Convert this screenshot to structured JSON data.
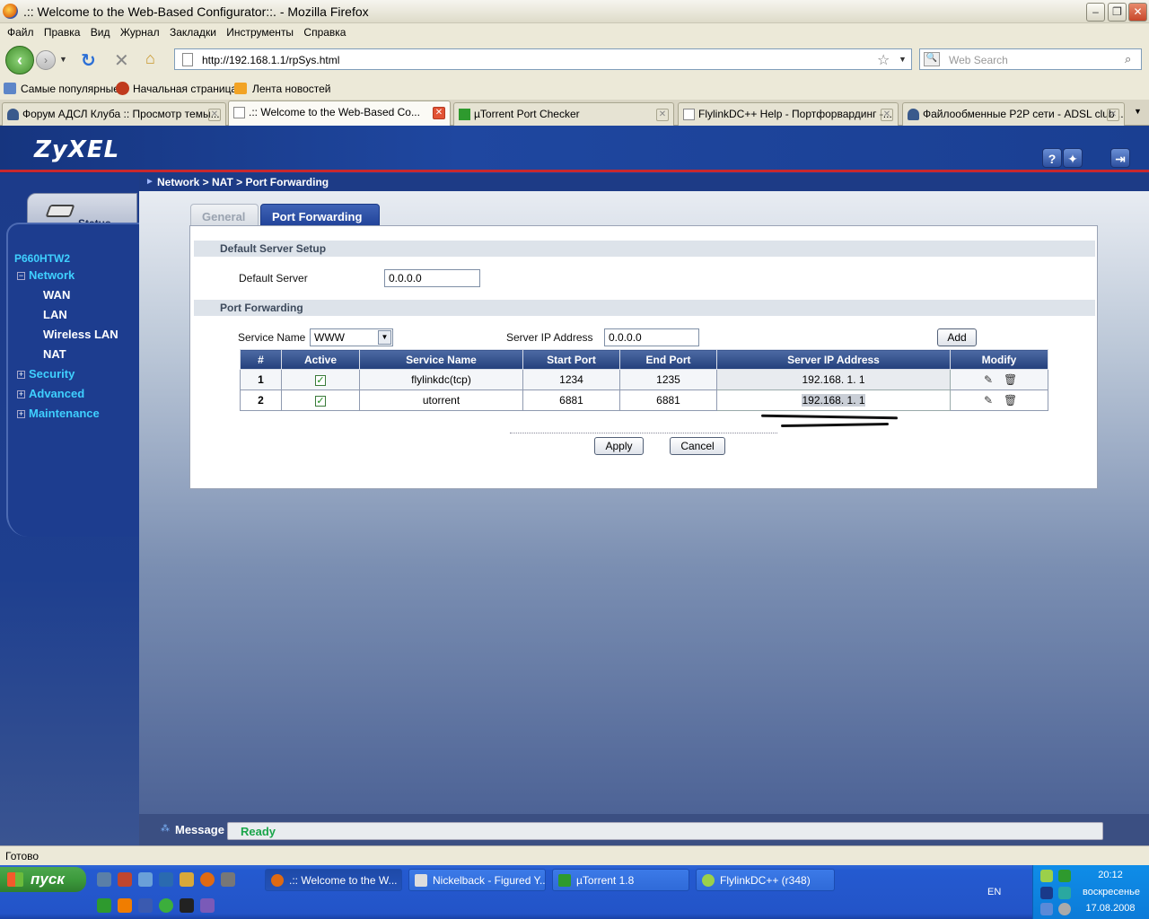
{
  "window": {
    "title": ".:: Welcome to the Web-Based Configurator::. - Mozilla Firefox"
  },
  "menu": [
    "Файл",
    "Правка",
    "Вид",
    "Журнал",
    "Закладки",
    "Инструменты",
    "Справка"
  ],
  "nav": {
    "url": "http://192.168.1.1/rpSys.html",
    "search_placeholder": "Web Search"
  },
  "bookmarks": [
    "Самые популярные",
    "Начальная страница",
    "Лента новостей"
  ],
  "tabs": [
    {
      "label": "Форум АДСЛ Клуба :: Просмотр темы..."
    },
    {
      "label": ".:: Welcome to the Web-Based Co..."
    },
    {
      "label": "µTorrent Port Checker"
    },
    {
      "label": "FlylinkDC++ Help - Портфорвардинг -..."
    },
    {
      "label": "Файлообменные P2P сети - ADSL club ..."
    }
  ],
  "router": {
    "brand": "ZyXEL",
    "breadcrumb": "Network > NAT > Port Forwarding",
    "status_tab": "Status",
    "model": "P660HTW2",
    "nav": {
      "network": "Network",
      "wan": "WAN",
      "lan": "LAN",
      "wireless": "Wireless LAN",
      "nat": "NAT",
      "security": "Security",
      "advanced": "Advanced",
      "maintenance": "Maintenance"
    },
    "page_tabs": {
      "general": "General",
      "port_forwarding": "Port Forwarding"
    },
    "default_section": {
      "title": "Default Server Setup",
      "label": "Default Server",
      "value": "0.0.0.0"
    },
    "pf_section": {
      "title": "Port Forwarding",
      "service_name_label": "Service Name",
      "service_name_value": "WWW",
      "server_ip_label": "Server IP Address",
      "server_ip_value": "0.0.0.0",
      "add_label": "Add"
    },
    "table": {
      "headers": [
        "#",
        "Active",
        "Service Name",
        "Start Port",
        "End Port",
        "Server IP Address",
        "Modify"
      ],
      "rows": [
        {
          "num": "1",
          "active": "✓",
          "name": "flylinkdc(tcp)",
          "start": "1234",
          "end": "1235",
          "ip": "192.168. 1. 1"
        },
        {
          "num": "2",
          "active": "✓",
          "name": "utorrent",
          "start": "6881",
          "end": "6881",
          "ip": "192.168. 1. 1"
        }
      ]
    },
    "apply_label": "Apply",
    "cancel_label": "Cancel",
    "message_label": "Message",
    "message_value": "Ready"
  },
  "statusbar": "Готово",
  "taskbar": {
    "start": "пуск",
    "items": [
      ".:: Welcome to the W...",
      "Nickelback - Figured Y...",
      "µTorrent 1.8",
      "FlylinkDC++ (r348)"
    ],
    "lang": "EN",
    "time": "20:12",
    "day": "воскресенье",
    "date": "17.08.2008"
  },
  "colors": {
    "accent_blue": "#1f47a0",
    "ready_green": "#1aa54a",
    "brand_red": "#c8282e"
  }
}
